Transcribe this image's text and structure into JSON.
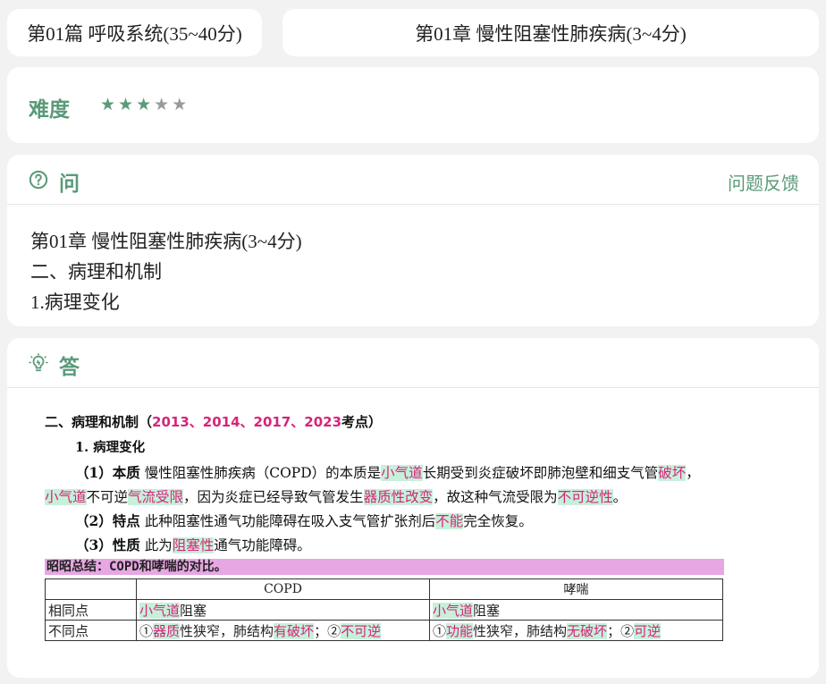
{
  "header": {
    "section_chip": "第01篇 呼吸系统(35~40分)",
    "chapter_chip": "第01章 慢性阻塞性肺疾病(3~4分)"
  },
  "difficulty": {
    "label": "难度",
    "rating": 3,
    "max": 5,
    "star_on_color": "#5a9a78",
    "star_off_color": "#9a9a9a"
  },
  "question": {
    "icon": "question-circle-icon",
    "title": "问",
    "feedback_label": "问题反馈",
    "lines": [
      "第01章 慢性阻塞性肺疾病(3~4分)",
      "二、病理和机制",
      "1.病理变化"
    ]
  },
  "answer": {
    "icon": "lightbulb-icon",
    "title": "答",
    "heading_prefix": "二、病理和机制（",
    "heading_years": "2013、2014、2017、2023",
    "heading_suffix": "考点）",
    "sub_heading": "1. 病理变化",
    "p1_label": "（1）本质",
    "p1_a": "慢性阻塞性肺疾病（COPD）的本质是",
    "p1_hl1": "小气道",
    "p1_b": "长期受到炎症破坏即肺泡壁和细支气管",
    "p1_hl2": "破坏",
    "p1_c": "，",
    "p1_hl3": "小气道",
    "p1_d": "不可逆",
    "p1_hl4": "气流受限",
    "p1_e": "，因为炎症已经导致气管发生",
    "p1_hl5": "器质性改变",
    "p1_f": "，故这种气流受限为",
    "p1_hl6": "不可逆性",
    "p1_g": "。",
    "p2_label": "（2）特点",
    "p2_a": "此种阻塞性通气功能障碍在吸入支气管扩张剂后",
    "p2_hl": "不能",
    "p2_b": "完全恢复。",
    "p3_label": "（3）性质",
    "p3_a": "此为",
    "p3_hl": "阻塞性",
    "p3_b": "通气功能障碍。",
    "summary": "昭昭总结：COPD和哮喘的对比。",
    "table": {
      "col_copd": "COPD",
      "col_asthma": "哮喘",
      "row1_label": "相同点",
      "row1_copd_hl": "小气道",
      "row1_copd_rest": "阻塞",
      "row1_asthma_hl": "小气道",
      "row1_asthma_rest": "阻塞",
      "row2_label": "不同点",
      "row2_copd_a": "①",
      "row2_copd_hl1": "器质",
      "row2_copd_b": "性狭窄，肺结构",
      "row2_copd_hl2": "有破坏",
      "row2_copd_c": "；②",
      "row2_copd_hl3": "不可逆",
      "row2_asthma_a": "①",
      "row2_asthma_hl1": "功能",
      "row2_asthma_b": "性狭窄，肺结构",
      "row2_asthma_hl2": "无破坏",
      "row2_asthma_c": "；②",
      "row2_asthma_hl3": "可逆"
    }
  }
}
